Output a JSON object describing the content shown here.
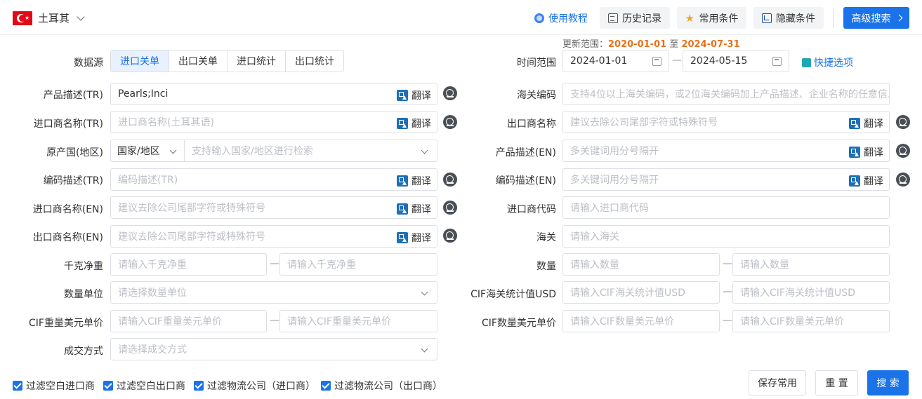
{
  "header": {
    "country": "土耳其",
    "tutorial": "使用教程",
    "history": "历史记录",
    "favorites": "常用条件",
    "hide": "隐藏条件",
    "advanced": "高级搜索"
  },
  "update_range": {
    "label": "更新范围：",
    "start": "2020-01-01",
    "sep": "至",
    "end": "2024-07-31"
  },
  "form": {
    "data_source": {
      "label": "数据源",
      "options": [
        "进口关单",
        "出口关单",
        "进口统计",
        "出口统计"
      ],
      "selected": "进口关单"
    },
    "time_range": {
      "label": "时间范围",
      "start": "2024-01-01",
      "end": "2024-05-15",
      "quick": "快捷选项"
    },
    "translate_label": "翻译",
    "range_sep": "—",
    "left": [
      {
        "label": "产品描述(TR)",
        "value": "Pearls;Inci",
        "placeholder": ""
      },
      {
        "label": "进口商名称(TR)",
        "value": "",
        "placeholder": "进口商名称(土耳其语)"
      },
      {
        "label": "原产国(地区)",
        "select": "国家/地区",
        "placeholder": "支持输入国家/地区进行检索"
      },
      {
        "label": "编码描述(TR)",
        "value": "",
        "placeholder": "编码描述(TR)"
      },
      {
        "label": "进口商名称(EN)",
        "value": "",
        "placeholder": "建议去除公司尾部字符或特殊符号"
      },
      {
        "label": "出口商名称(EN)",
        "value": "",
        "placeholder": "建议去除公司尾部字符或特殊符号"
      },
      {
        "label": "千克净重",
        "placeholder_min": "请输入千克净重",
        "placeholder_max": "请输入千克净重"
      },
      {
        "label": "数量单位",
        "placeholder": "请选择数量单位"
      },
      {
        "label": "CIF重量美元单价",
        "placeholder_min": "请输入CIF重量美元单价",
        "placeholder_max": "请输入CIF重量美元单价"
      },
      {
        "label": "成交方式",
        "placeholder": "请选择成交方式"
      }
    ],
    "right": [
      {
        "label": "海关编码",
        "placeholder": "支持4位以上海关编码，或2位海关编码加上产品描述、企业名称的任意信..."
      },
      {
        "label": "出口商名称",
        "placeholder": "建议去除公司尾部字符或特殊符号"
      },
      {
        "label": "产品描述(EN)",
        "placeholder": "多关键词用分号隔开"
      },
      {
        "label": "编码描述(EN)",
        "placeholder": "多关键词用分号隔开"
      },
      {
        "label": "进口商代码",
        "placeholder": "请输入进口商代码"
      },
      {
        "label": "海关",
        "placeholder": "请输入海关"
      },
      {
        "label": "数量",
        "placeholder_min": "请输入数量",
        "placeholder_max": "请输入数量"
      },
      {
        "label": "CIF海关统计值USD",
        "placeholder_min": "请输入CIF海关统计值USD",
        "placeholder_max": "请输入CIF海关统计值USD"
      },
      {
        "label": "CIF数量美元单价",
        "placeholder_min": "请输入CIF数量美元单价",
        "placeholder_max": "请输入CIF数量美元单价"
      }
    ]
  },
  "filters": [
    {
      "label": "过滤空白进口商",
      "checked": true
    },
    {
      "label": "过滤空白出口商",
      "checked": true
    },
    {
      "label": "过滤物流公司（进口商）",
      "checked": true
    },
    {
      "label": "过滤物流公司（出口商）",
      "checked": true
    }
  ],
  "actions": {
    "save": "保存常用",
    "reset": "重 置",
    "search": "搜 索"
  },
  "colors": {
    "primary": "#1a73e8",
    "accent": "#e8711a"
  }
}
